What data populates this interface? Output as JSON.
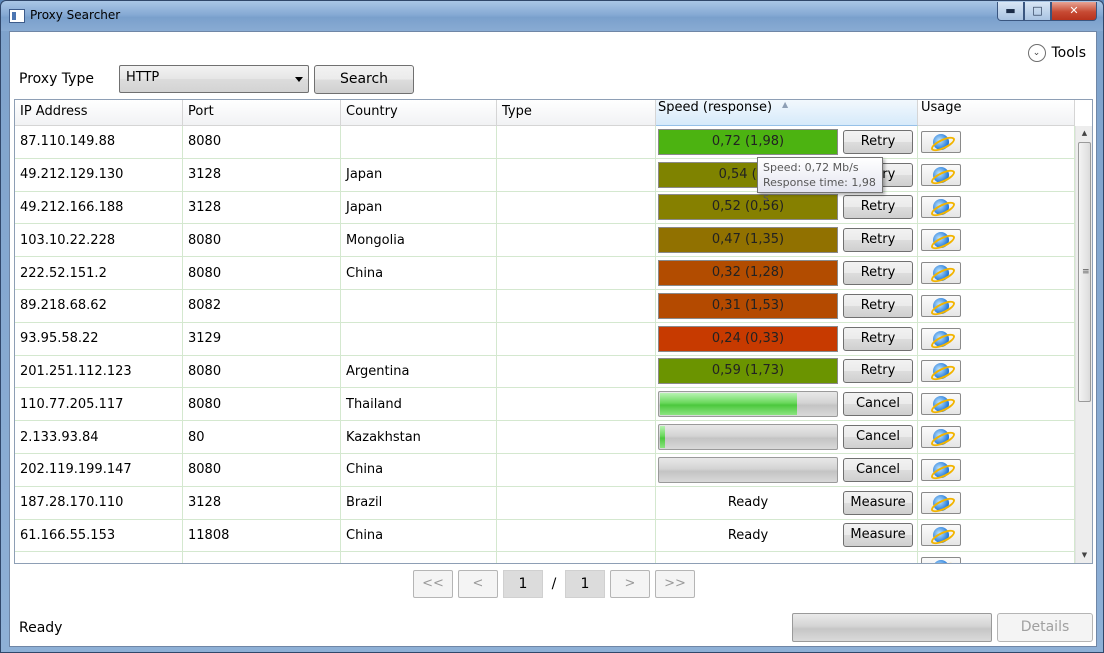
{
  "window": {
    "title": "Proxy Searcher",
    "minimize_glyph": "▬",
    "maximize_glyph": "□",
    "close_glyph": "✕"
  },
  "toolbar": {
    "tools_label": "Tools",
    "tools_glyph": "⌄",
    "proxy_type_label": "Proxy Type",
    "proxy_type_value": "HTTP",
    "search_label": "Search"
  },
  "grid": {
    "columns": [
      "IP Address",
      "Port",
      "Country",
      "Type",
      "Speed (response)",
      "Usage"
    ],
    "sort_glyph": "▲",
    "rows": [
      {
        "ip": "87.110.149.88",
        "port": "8080",
        "country": "",
        "type": "",
        "state": "result",
        "speed": "0,72 (1,98)",
        "color": "#4cb311",
        "action": "Retry"
      },
      {
        "ip": "49.212.129.130",
        "port": "3128",
        "country": "Japan",
        "type": "",
        "state": "result",
        "speed": "0,54 (0,9",
        "color": "#7f8300",
        "action": "Retry"
      },
      {
        "ip": "49.212.166.188",
        "port": "3128",
        "country": "Japan",
        "type": "",
        "state": "result",
        "speed": "0,52 (0,56)",
        "color": "#868000",
        "action": "Retry"
      },
      {
        "ip": "103.10.22.228",
        "port": "8080",
        "country": "Mongolia",
        "type": "",
        "state": "result",
        "speed": "0,47 (1,35)",
        "color": "#917100",
        "action": "Retry"
      },
      {
        "ip": "222.52.151.2",
        "port": "8080",
        "country": "China",
        "type": "",
        "state": "result",
        "speed": "0,32 (1,28)",
        "color": "#b24c00",
        "action": "Retry"
      },
      {
        "ip": "89.218.68.62",
        "port": "8082",
        "country": "",
        "type": "",
        "state": "result",
        "speed": "0,31 (1,53)",
        "color": "#b44a00",
        "action": "Retry"
      },
      {
        "ip": "93.95.58.22",
        "port": "3129",
        "country": "",
        "type": "",
        "state": "result",
        "speed": "0,24 (0,33)",
        "color": "#c73a00",
        "action": "Retry"
      },
      {
        "ip": "201.251.112.123",
        "port": "8080",
        "country": "Argentina",
        "type": "",
        "state": "result",
        "speed": "0,59 (1,73)",
        "color": "#6b9400",
        "action": "Retry"
      },
      {
        "ip": "110.77.205.117",
        "port": "8080",
        "country": "Thailand",
        "type": "",
        "state": "progress",
        "progress": 0.77,
        "action": "Cancel"
      },
      {
        "ip": "2.133.93.84",
        "port": "80",
        "country": "Kazakhstan",
        "type": "",
        "state": "progress",
        "progress": 0.03,
        "action": "Cancel"
      },
      {
        "ip": "202.119.199.147",
        "port": "8080",
        "country": "China",
        "type": "",
        "state": "progress",
        "progress": 0.0,
        "action": "Cancel"
      },
      {
        "ip": "187.28.170.110",
        "port": "3128",
        "country": "Brazil",
        "type": "",
        "state": "ready",
        "ready_text": "Ready",
        "action": "Measure"
      },
      {
        "ip": "61.166.55.153",
        "port": "11808",
        "country": "China",
        "type": "",
        "state": "ready",
        "ready_text": "Ready",
        "action": "Measure"
      },
      {
        "ip": "",
        "port": "",
        "country": "",
        "type": "",
        "state": "ready",
        "ready_text": "",
        "action": ""
      }
    ],
    "usage_icon": "internet-explorer-icon"
  },
  "tooltip": {
    "line1": "Speed: 0,72 Mb/s",
    "line2": "Response time: 1,98 s"
  },
  "scrollbar": {
    "up_glyph": "▲",
    "down_glyph": "▼",
    "grip_glyph": "≡"
  },
  "pager": {
    "first": "<<",
    "prev": "<",
    "current_page": "1",
    "separator": "/",
    "total_pages": "1",
    "next": ">",
    "last": ">>"
  },
  "status": {
    "text": "Ready",
    "details_label": "Details"
  }
}
